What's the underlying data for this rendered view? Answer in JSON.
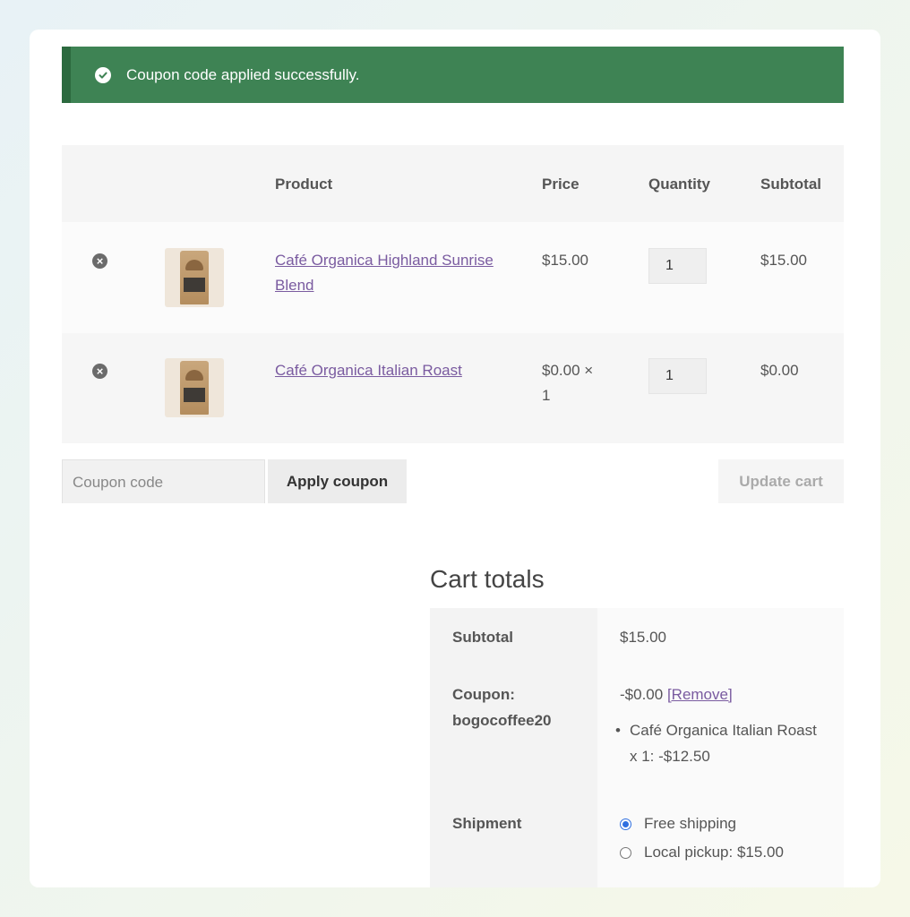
{
  "notice": {
    "message": "Coupon code applied successfully.",
    "icon": "check-circle-icon",
    "color": "#3e8354"
  },
  "cart_table": {
    "headers": {
      "product": "Product",
      "price": "Price",
      "quantity": "Quantity",
      "subtotal": "Subtotal"
    },
    "rows": [
      {
        "name_line1": "Café Organica Highland Sunrise",
        "name_line2": "Blend",
        "price": "$15.00",
        "price_line2": "",
        "quantity": "1",
        "subtotal": "$15.00"
      },
      {
        "name_line1": "Café Organica Italian Roast",
        "name_line2": "",
        "price": "$0.00 ×",
        "price_line2": "1",
        "quantity": "1",
        "subtotal": "$0.00"
      }
    ]
  },
  "actions": {
    "coupon_placeholder": "Coupon code",
    "apply_coupon_label": "Apply coupon",
    "update_cart_label": "Update cart"
  },
  "cart_totals": {
    "title": "Cart totals",
    "subtotal_label": "Subtotal",
    "subtotal_value": "$15.00",
    "coupon_label_line1": "Coupon:",
    "coupon_label_line2": "bogocoffee20",
    "coupon_value": "-$0.00",
    "coupon_remove_label": "[Remove]",
    "coupon_item_line1": "Café Organica Italian Roast",
    "coupon_item_line2": "x 1: -$12.50",
    "shipment_label": "Shipment",
    "shipping_options": [
      {
        "label": "Free shipping",
        "selected": true
      },
      {
        "label": "Local pickup: $15.00",
        "selected": false
      }
    ]
  },
  "colors": {
    "link": "#7a5ba0",
    "radio_selected": "#2f6fe0"
  }
}
